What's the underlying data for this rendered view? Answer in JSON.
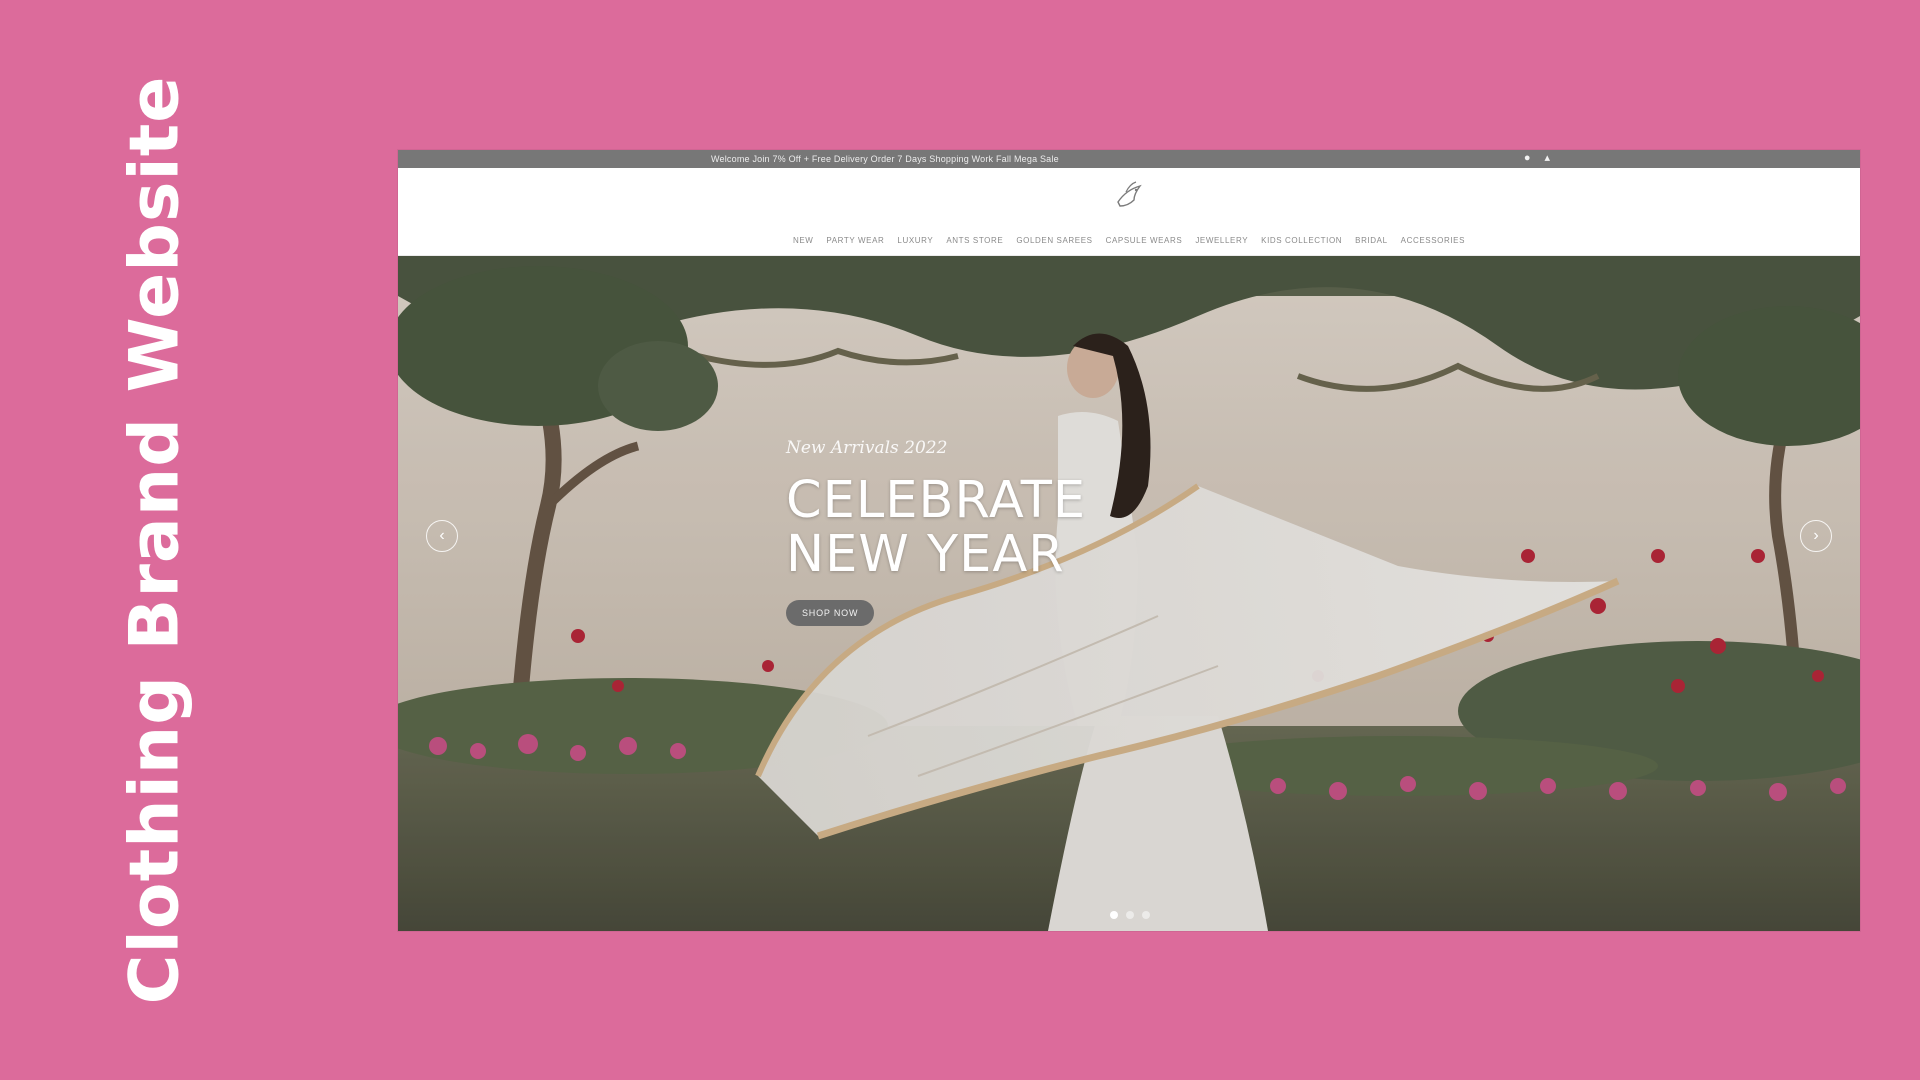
{
  "side_title": "Clothing Brand Website",
  "topbar": {
    "promo": "Welcome Join 7% Off + Free Delivery Order 7 Days Shopping Work Fall Mega Sale",
    "icons": [
      "user-icon",
      "cart-icon"
    ]
  },
  "header": {
    "logo_icon": "bird-logo-icon"
  },
  "nav": {
    "items": [
      "NEW",
      "PARTY WEAR",
      "LUXURY",
      "ANTS STORE",
      "GOLDEN SAREES",
      "CAPSULE WEARS",
      "JEWELLERY",
      "KIDS COLLECTION",
      "BRIDAL",
      "ACCESSORIES"
    ]
  },
  "hero": {
    "subtitle": "New Arrivals 2022",
    "title": "CELEBRATE NEW YEAR",
    "button": "SHOP NOW",
    "slide_count": 3,
    "active_slide": 1
  },
  "colors": {
    "background": "#dc6b9b",
    "topbar": "#777777",
    "button": "#6b6b6b"
  }
}
